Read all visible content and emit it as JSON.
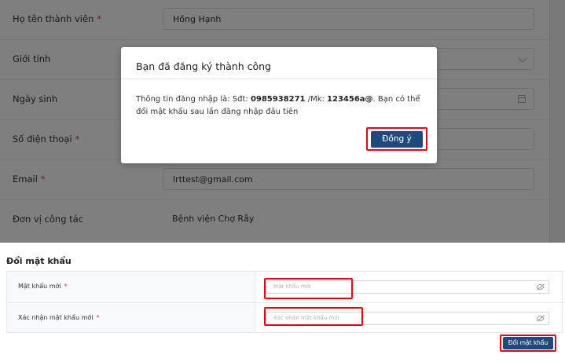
{
  "member_form": {
    "fields": [
      {
        "label": "Họ tên thành viên",
        "required": "*",
        "value": "Hồng Hạnh"
      },
      {
        "label": "Giới tính",
        "required": "",
        "value": ""
      },
      {
        "label": "Ngày sinh",
        "required": "",
        "value": ""
      },
      {
        "label": "Số điện thoại",
        "required": "*",
        "value": ""
      },
      {
        "label": "Email",
        "required": "*",
        "value": "lrttest@gmail.com"
      },
      {
        "label": "Đơn vị công tác",
        "required": "",
        "value": "Bệnh viện Chợ Rẫy"
      }
    ]
  },
  "modal": {
    "title": "Bạn đã đăng ký thành công",
    "message_prefix": "Thông tin đăng nhập là: Sđt: ",
    "phone": "0985938271",
    "message_mid": " /Mk: ",
    "password": "123456a@",
    "message_suffix": ". Bạn có thể đổi mật khẩu sau lần đăng nhập đầu tiên",
    "ok_label": "Đồng ý"
  },
  "change_password": {
    "title": "Đổi mật khẩu",
    "new_password_label": "Mật khẩu mới",
    "new_password_placeholder": "Mật khẩu mới",
    "confirm_label": "Xác nhận mật khẩu mới",
    "confirm_placeholder": "Xác nhận mật khẩu mới",
    "required": "*",
    "submit_label": "Đổi mật khẩu"
  },
  "colors": {
    "primary": "#1f4a7d",
    "required": "#dc3545",
    "highlight": "#e3001b"
  }
}
